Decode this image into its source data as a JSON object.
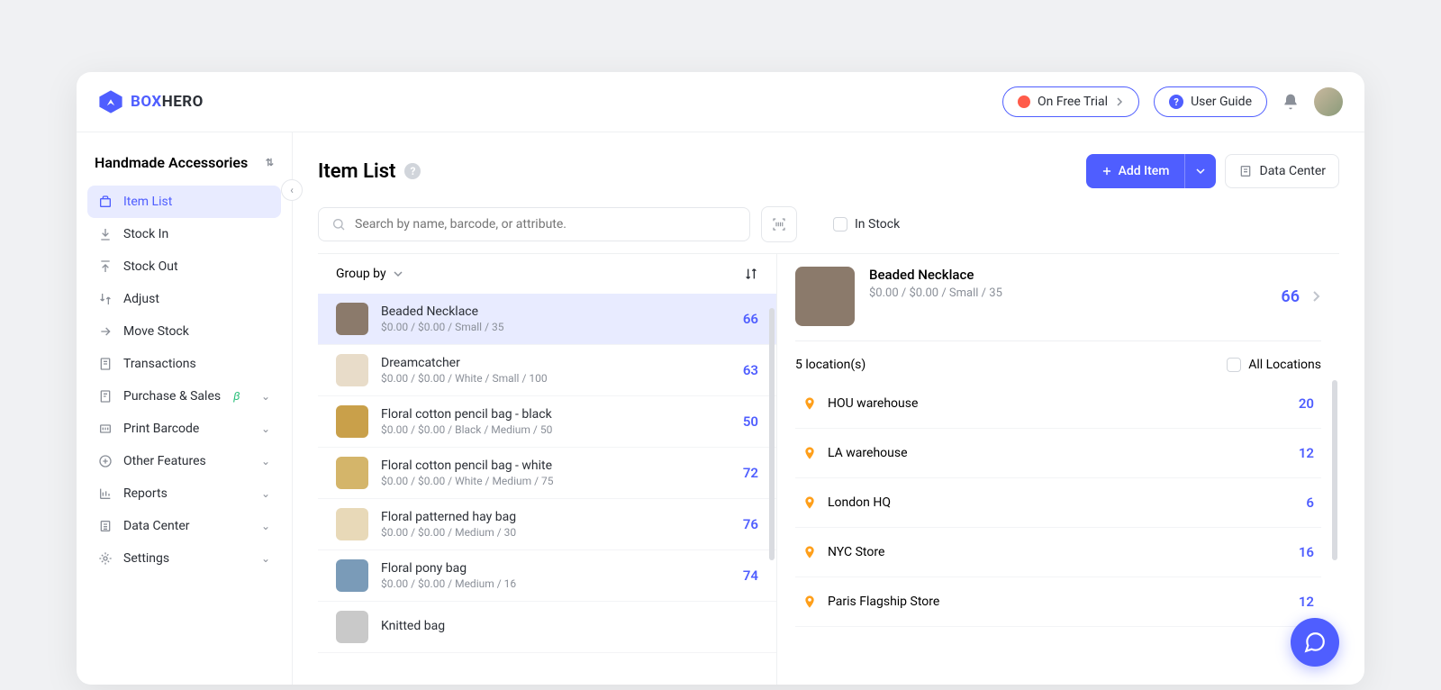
{
  "header": {
    "logo_box": "BOX",
    "logo_hero": "HERO",
    "trial_label": "On Free Trial",
    "guide_label": "User Guide"
  },
  "sidebar": {
    "workspace": "Handmade Accessories",
    "items": [
      {
        "label": "Item List"
      },
      {
        "label": "Stock In"
      },
      {
        "label": "Stock Out"
      },
      {
        "label": "Adjust"
      },
      {
        "label": "Move Stock"
      },
      {
        "label": "Transactions"
      },
      {
        "label": "Purchase & Sales",
        "beta": "β"
      },
      {
        "label": "Print Barcode"
      },
      {
        "label": "Other Features"
      },
      {
        "label": "Reports"
      },
      {
        "label": "Data Center"
      },
      {
        "label": "Settings"
      }
    ]
  },
  "page": {
    "title": "Item List",
    "add_item": "Add Item",
    "data_center": "Data Center",
    "search_placeholder": "Search by name, barcode, or attribute.",
    "in_stock": "In Stock",
    "group_by": "Group by"
  },
  "items": [
    {
      "name": "Beaded Necklace",
      "meta": "$0.00 / $0.00 / Small / 35",
      "qty": "66",
      "thumb": "#8b7a6b"
    },
    {
      "name": "Dreamcatcher",
      "meta": "$0.00 / $0.00 / White / Small / 100",
      "qty": "63",
      "thumb": "#e8dcc9"
    },
    {
      "name": "Floral cotton pencil bag - black",
      "meta": "$0.00 / $0.00 / Black / Medium / 50",
      "qty": "50",
      "thumb": "#c9a04a"
    },
    {
      "name": "Floral cotton pencil bag - white",
      "meta": "$0.00 / $0.00 / White / Medium / 75",
      "qty": "72",
      "thumb": "#d4b56a"
    },
    {
      "name": "Floral patterned hay bag",
      "meta": "$0.00 / $0.00 / Medium / 30",
      "qty": "76",
      "thumb": "#e8d9b8"
    },
    {
      "name": "Floral pony bag",
      "meta": "$0.00 / $0.00 / Medium / 16",
      "qty": "74",
      "thumb": "#7a9bb8"
    },
    {
      "name": "Knitted bag",
      "meta": "",
      "qty": "",
      "thumb": "#c9c9c9"
    }
  ],
  "detail": {
    "name": "Beaded Necklace",
    "meta": "$0.00 / $0.00 / Small / 35",
    "qty": "66",
    "location_count": "5 location(s)",
    "all_locations": "All Locations",
    "locations": [
      {
        "name": "HOU warehouse",
        "qty": "20"
      },
      {
        "name": "LA warehouse",
        "qty": "12"
      },
      {
        "name": "London HQ",
        "qty": "6"
      },
      {
        "name": "NYC Store",
        "qty": "16"
      },
      {
        "name": "Paris Flagship Store",
        "qty": "12"
      }
    ]
  }
}
